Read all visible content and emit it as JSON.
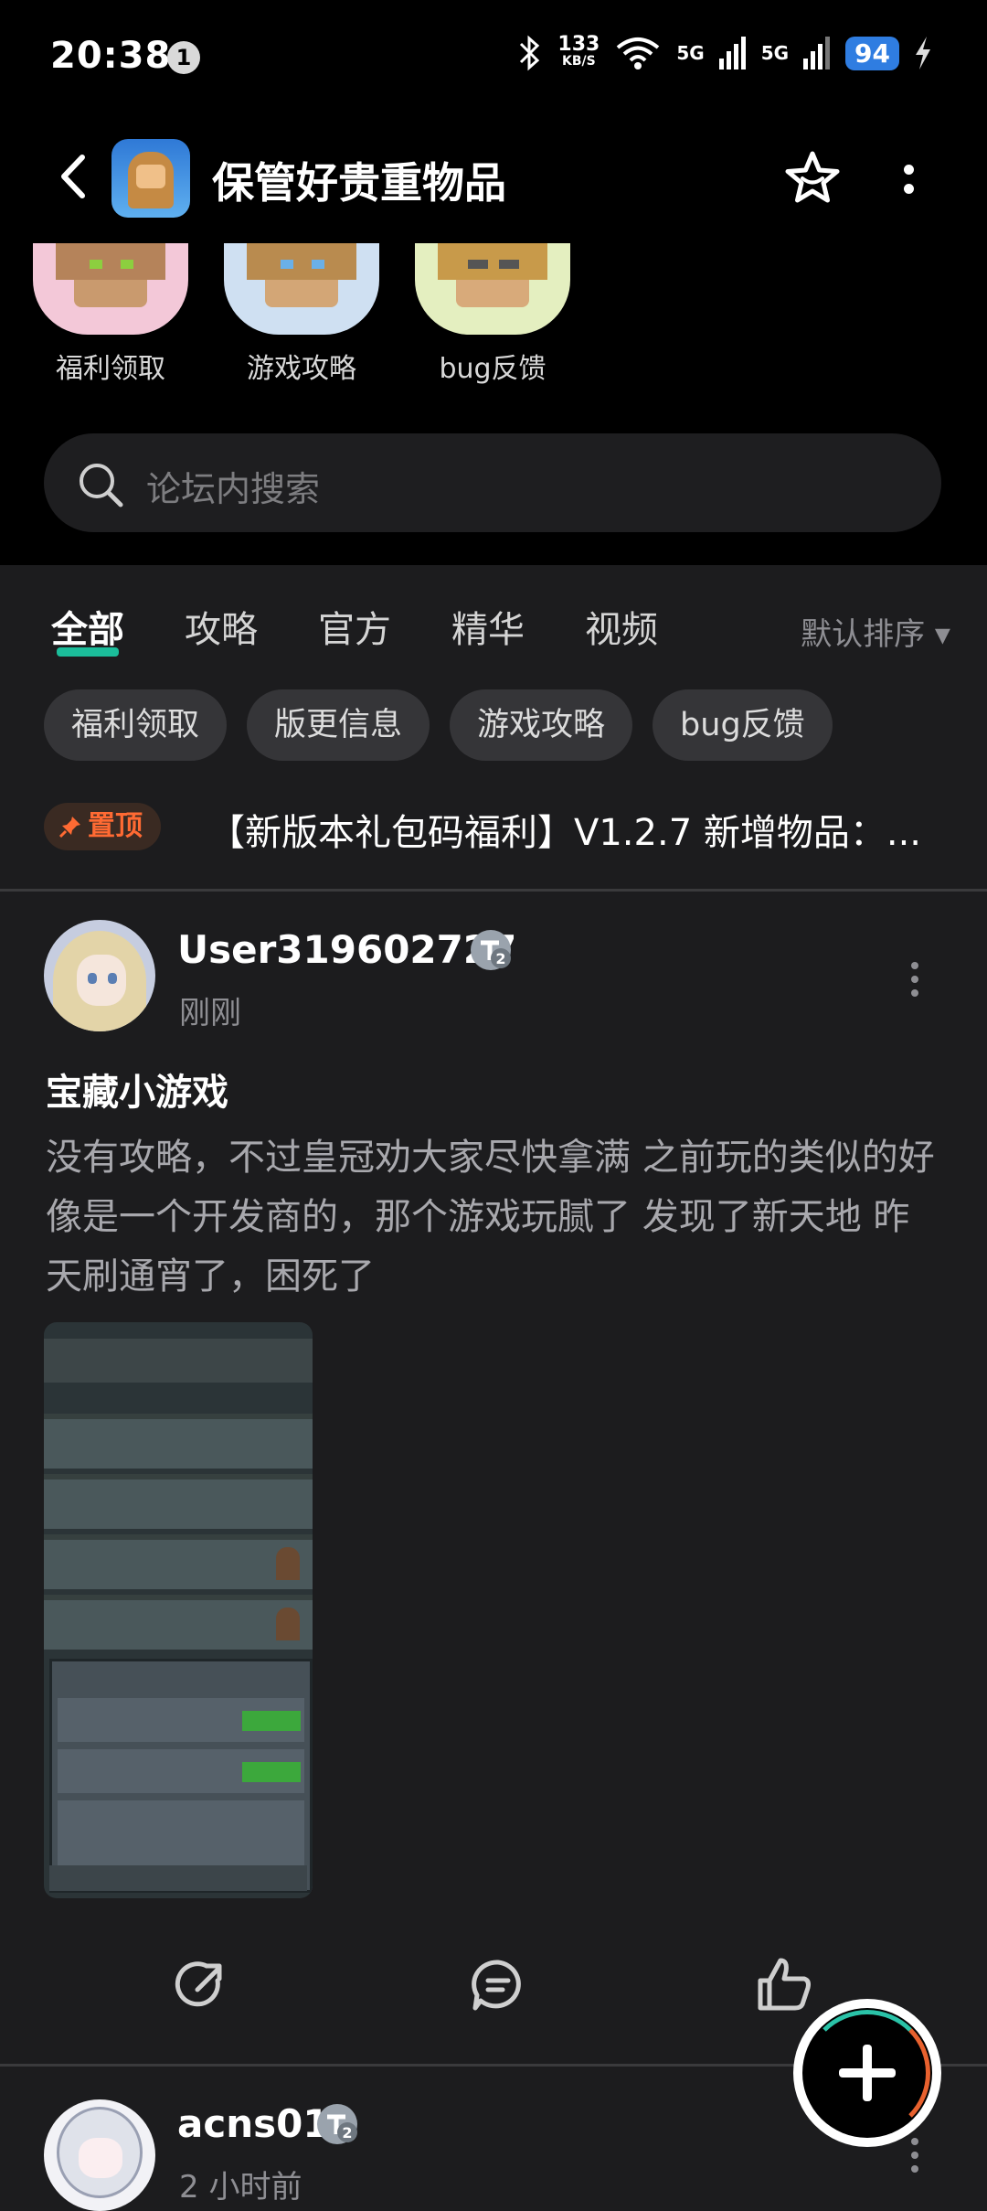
{
  "status_bar": {
    "time": "20:38",
    "notification_count": "1",
    "net_speed_value": "133",
    "net_speed_unit": "KB/S",
    "signal_1": "5G",
    "signal_2": "5G",
    "battery": "94"
  },
  "header": {
    "title": "保管好贵重物品"
  },
  "categories": [
    {
      "label": "福利领取",
      "bg": "#f3c8d8",
      "hair": "#b5835a",
      "face": "#c99a6e",
      "eyes": "#8ccf3f"
    },
    {
      "label": "游戏攻略",
      "bg": "#cfe0f2",
      "hair": "#b98b4f",
      "face": "#d3a676",
      "eyes": "#6ab0e8"
    },
    {
      "label": "bug反馈",
      "bg": "#e4efc0",
      "hair": "#c89a4a",
      "face": "#d8aa7a",
      "eyes": "#555555"
    }
  ],
  "search": {
    "placeholder": "论坛内搜索"
  },
  "tabs": [
    {
      "label": "全部",
      "active": true
    },
    {
      "label": "攻略",
      "active": false
    },
    {
      "label": "官方",
      "active": false
    },
    {
      "label": "精华",
      "active": false
    },
    {
      "label": "视频",
      "active": false
    }
  ],
  "sort": {
    "label": "默认排序 ▾"
  },
  "chips": [
    "福利领取",
    "版更信息",
    "游戏攻略",
    "bug反馈"
  ],
  "pinned": {
    "badge": "置顶",
    "text": "【新版本礼包码福利】V1.2.7 新增物品：..."
  },
  "posts": [
    {
      "username": "User319602727",
      "level": "2",
      "time": "刚刚",
      "title": "宝藏小游戏",
      "body": "没有攻略，不过皇冠劝大家尽快拿满 之前玩的类似的好像是一个开发商的，那个游戏玩腻了 发现了新天地 昨天刷通宵了，困死了"
    },
    {
      "username": "acns01",
      "level": "2",
      "time": "2 小时前"
    }
  ],
  "colors": {
    "accent": "#1bbd9a",
    "pin_orange": "#ff6a33",
    "background": "#1c1c1e",
    "header_bg": "#000000"
  },
  "icons": {
    "back": "chevron-left-icon",
    "favorite": "star-icon",
    "more": "more-vertical-icon",
    "search": "search-icon",
    "share": "share-icon",
    "comment": "comment-icon",
    "like": "thumbs-up-icon",
    "compose": "plus-icon"
  }
}
